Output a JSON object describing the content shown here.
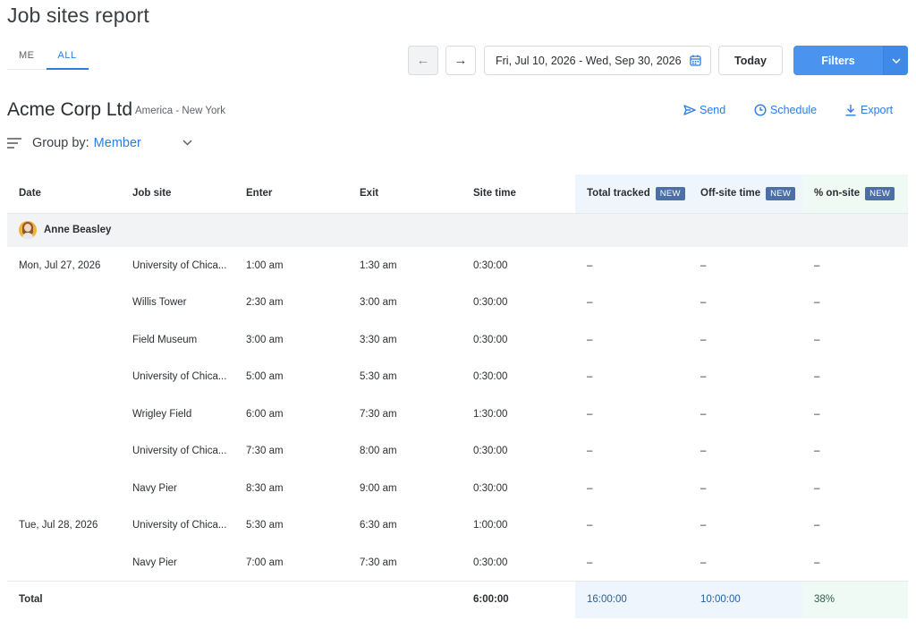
{
  "page": {
    "title": "Job sites report"
  },
  "scope_tabs": [
    {
      "label": "ME",
      "active": false
    },
    {
      "label": "ALL",
      "active": true
    }
  ],
  "toolbar": {
    "prev_glyph": "←",
    "next_glyph": "→",
    "date_range": "Fri, Jul 10, 2026 - Wed, Sep 30, 2026",
    "today_label": "Today",
    "filters_label": "Filters"
  },
  "org": {
    "name": "Acme Corp Ltd",
    "timezone": "America - New York"
  },
  "actions": {
    "send": "Send",
    "schedule": "Schedule",
    "export": "Export"
  },
  "group_by": {
    "label": "Group by:",
    "value": "Member"
  },
  "table": {
    "columns": {
      "date": "Date",
      "job_site": "Job site",
      "enter": "Enter",
      "exit": "Exit",
      "site_time": "Site time",
      "total_tracked": "Total tracked",
      "off_site_time": "Off-site time",
      "pct_on_site": "% on-site",
      "new_badge": "NEW"
    },
    "group": {
      "member": "Anne Beasley"
    },
    "rows": [
      {
        "date": "Mon, Jul 27, 2026",
        "site": "University of Chica...",
        "enter": "1:00 am",
        "exit": "1:30 am",
        "site_time": "0:30:00",
        "tracked": "–",
        "off": "–",
        "pct": "–"
      },
      {
        "date": "",
        "site": "Willis Tower",
        "enter": "2:30 am",
        "exit": "3:00 am",
        "site_time": "0:30:00",
        "tracked": "–",
        "off": "–",
        "pct": "–"
      },
      {
        "date": "",
        "site": "Field Museum",
        "enter": "3:00 am",
        "exit": "3:30 am",
        "site_time": "0:30:00",
        "tracked": "–",
        "off": "–",
        "pct": "–"
      },
      {
        "date": "",
        "site": "University of Chica...",
        "enter": "5:00 am",
        "exit": "5:30 am",
        "site_time": "0:30:00",
        "tracked": "–",
        "off": "–",
        "pct": "–"
      },
      {
        "date": "",
        "site": "Wrigley Field",
        "enter": "6:00 am",
        "exit": "7:30 am",
        "site_time": "1:30:00",
        "tracked": "–",
        "off": "–",
        "pct": "–"
      },
      {
        "date": "",
        "site": "University of Chica...",
        "enter": "7:30 am",
        "exit": "8:00 am",
        "site_time": "0:30:00",
        "tracked": "–",
        "off": "–",
        "pct": "–"
      },
      {
        "date": "",
        "site": "Navy Pier",
        "enter": "8:30 am",
        "exit": "9:00 am",
        "site_time": "0:30:00",
        "tracked": "–",
        "off": "–",
        "pct": "–"
      },
      {
        "date": "Tue, Jul 28, 2026",
        "site": "University of Chica...",
        "enter": "5:30 am",
        "exit": "6:30 am",
        "site_time": "1:00:00",
        "tracked": "–",
        "off": "–",
        "pct": "–"
      },
      {
        "date": "",
        "site": "Navy Pier",
        "enter": "7:00 am",
        "exit": "7:30 am",
        "site_time": "0:30:00",
        "tracked": "–",
        "off": "–",
        "pct": "–"
      }
    ],
    "total": {
      "label": "Total",
      "site_time": "6:00:00",
      "tracked": "16:00:00",
      "off": "10:00:00",
      "pct": "38%"
    }
  },
  "colors": {
    "accent": "#2a7de1",
    "filters_bg": "#4a94f0",
    "tracked_bg": "#eef5fd",
    "onsite_bg": "#eefaf3",
    "badge_bg": "#4c6fa6"
  },
  "icons": {
    "prev": "arrow-left-icon",
    "next": "arrow-right-icon",
    "calendar": "calendar-icon",
    "filters_caret": "chevron-down-icon",
    "send": "send-icon",
    "schedule": "clock-icon",
    "export": "download-icon",
    "group": "lines-icon",
    "group_caret": "chevron-down-icon"
  }
}
